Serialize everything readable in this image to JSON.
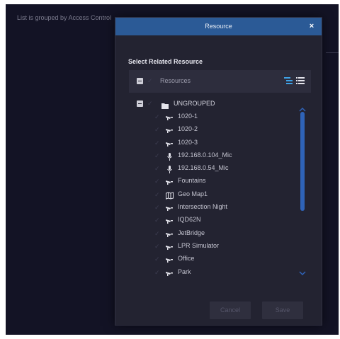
{
  "background": {
    "hint_text": "List is grouped by Access Control"
  },
  "dialog": {
    "title": "Resource",
    "close_label": "×",
    "section_title": "Select Related Resource",
    "root_label": "Resources",
    "group_label": "UNGROUPED",
    "items": [
      {
        "label": "1020-1",
        "icon": "camera-icon"
      },
      {
        "label": "1020-2",
        "icon": "camera-icon"
      },
      {
        "label": "1020-3",
        "icon": "camera-icon"
      },
      {
        "label": "192.168.0.104_Mic",
        "icon": "microphone-icon"
      },
      {
        "label": "192.168.0.54_Mic",
        "icon": "microphone-icon"
      },
      {
        "label": "Fountains",
        "icon": "camera-icon"
      },
      {
        "label": "Geo Map1",
        "icon": "map-icon"
      },
      {
        "label": "Intersection Night",
        "icon": "camera-icon"
      },
      {
        "label": "IQD62N",
        "icon": "camera-icon"
      },
      {
        "label": "JetBridge",
        "icon": "camera-icon"
      },
      {
        "label": "LPR Simulator",
        "icon": "camera-icon"
      },
      {
        "label": "Office",
        "icon": "camera-icon"
      },
      {
        "label": "Park",
        "icon": "camera-icon"
      }
    ],
    "cancel_label": "Cancel",
    "save_label": "Save"
  },
  "colors": {
    "header": "#2b5a96",
    "dialog_bg": "#232331",
    "scrollbar": "#2f63b8"
  }
}
